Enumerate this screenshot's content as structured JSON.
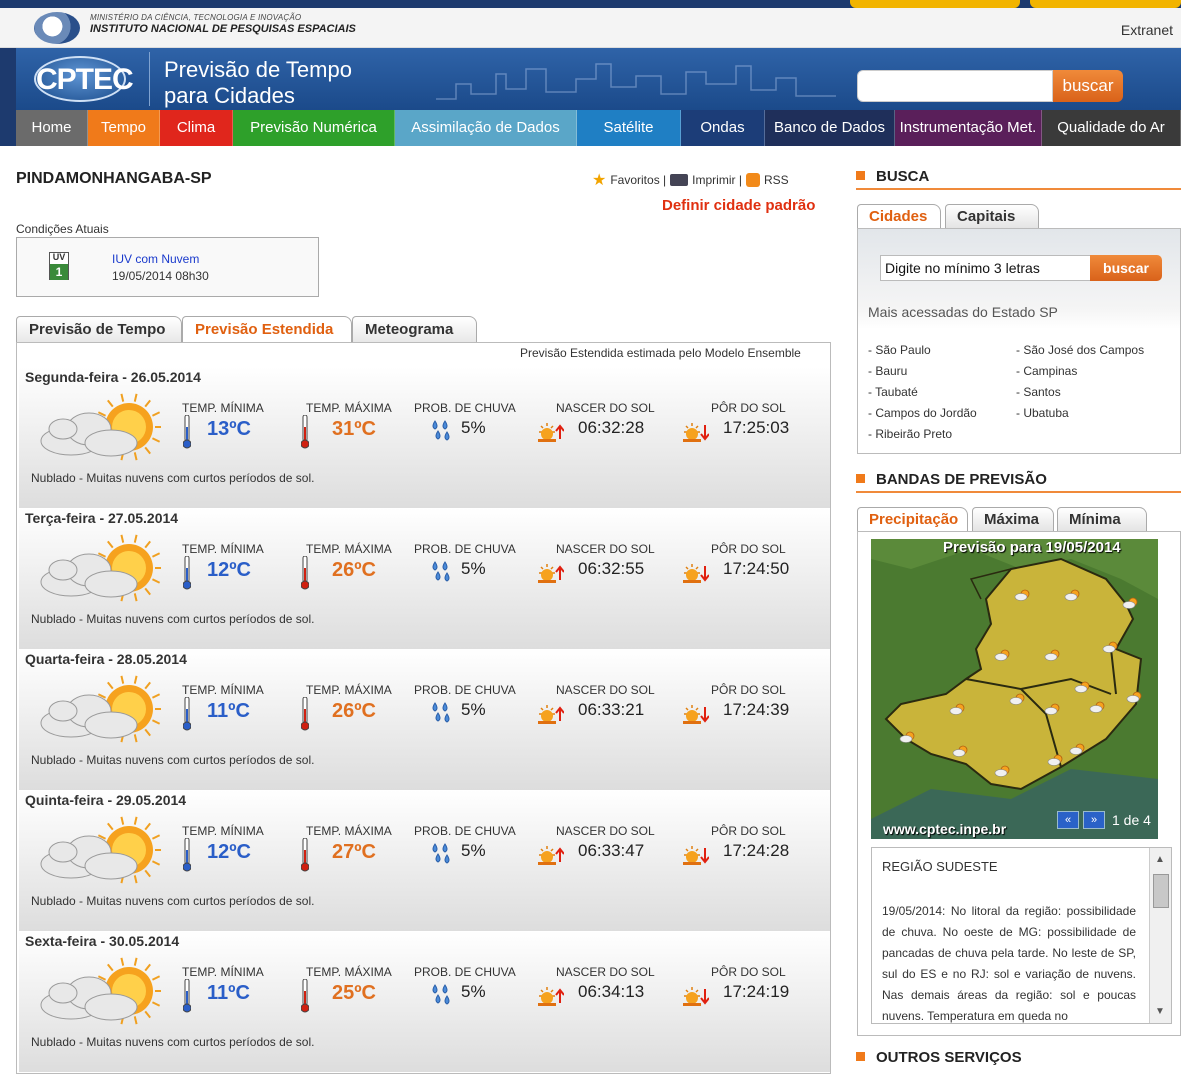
{
  "institution": {
    "line1": "MINISTÉRIO DA CIÊNCIA, TECNOLOGIA E INOVAÇÃO",
    "line2": "INSTITUTO NACIONAL DE PESQUISAS ESPACIAIS",
    "extranet": "Extranet"
  },
  "header": {
    "logo": "CPTEC",
    "title_line1": "Previsão de Tempo",
    "title_line2": "para Cidades",
    "search_button": "buscar"
  },
  "nav": [
    {
      "label": "Home",
      "color": "#6b6b6b"
    },
    {
      "label": "Tempo",
      "color": "#f07a1a"
    },
    {
      "label": "Clima",
      "color": "#e0261c"
    },
    {
      "label": "Previsão Numérica",
      "color": "#2ea02a"
    },
    {
      "label": "Assimilação de Dados",
      "color": "#5aa6c8"
    },
    {
      "label": "Satélite",
      "color": "#1f7fc4"
    },
    {
      "label": "Ondas",
      "color": "#1c3d78"
    },
    {
      "label": "Banco de Dados",
      "color": "#1f2f5a"
    },
    {
      "label": "Instrumentação Met.",
      "color": "#5a1f5a"
    },
    {
      "label": "Qualidade do Ar",
      "color": "#3a3a3a"
    }
  ],
  "city": {
    "name": "PINDAMONHANGABA-SP",
    "favoritos": "Favoritos |",
    "imprimir": "Imprimir |",
    "rss": "RSS",
    "define": "Definir cidade padrão"
  },
  "current": {
    "label": "Condições Atuais",
    "uv_label": "UV",
    "uv_value": "1",
    "link": "IUV com Nuvem",
    "date": "19/05/2014 08h30"
  },
  "tabs": [
    "Previsão de Tempo",
    "Previsão Estendida",
    "Meteograma"
  ],
  "ensemble_note": "Previsão Estendida estimada pelo Modelo Ensemble",
  "labels": {
    "min": "TEMP. MÍNIMA",
    "max": "TEMP. MÁXIMA",
    "rain": "PROB. DE CHUVA",
    "sunrise": "NASCER DO SOL",
    "sunset": "PÔR DO SOL"
  },
  "days": [
    {
      "name": "Segunda-feira - 26.05.2014",
      "min": "13ºC",
      "max": "31ºC",
      "rain": "5%",
      "sunrise": "06:32:28",
      "sunset": "17:25:03",
      "desc": "Nublado - Muitas nuvens com curtos períodos de sol."
    },
    {
      "name": "Terça-feira - 27.05.2014",
      "min": "12ºC",
      "max": "26ºC",
      "rain": "5%",
      "sunrise": "06:32:55",
      "sunset": "17:24:50",
      "desc": "Nublado - Muitas nuvens com curtos períodos de sol."
    },
    {
      "name": "Quarta-feira - 28.05.2014",
      "min": "11ºC",
      "max": "26ºC",
      "rain": "5%",
      "sunrise": "06:33:21",
      "sunset": "17:24:39",
      "desc": "Nublado - Muitas nuvens com curtos períodos de sol."
    },
    {
      "name": "Quinta-feira - 29.05.2014",
      "min": "12ºC",
      "max": "27ºC",
      "rain": "5%",
      "sunrise": "06:33:47",
      "sunset": "17:24:28",
      "desc": "Nublado - Muitas nuvens com curtos períodos de sol."
    },
    {
      "name": "Sexta-feira - 30.05.2014",
      "min": "11ºC",
      "max": "25ºC",
      "rain": "5%",
      "sunrise": "06:34:13",
      "sunset": "17:24:19",
      "desc": "Nublado - Muitas nuvens com curtos períodos de sol."
    }
  ],
  "busca": {
    "title": "BUSCA",
    "tabs": [
      "Cidades",
      "Capitais"
    ],
    "placeholder": "Digite no mínimo 3 letras",
    "button": "buscar",
    "mais": "Mais acessadas do Estado SP",
    "col1": [
      "- São Paulo",
      "- Bauru",
      "- Taubaté",
      "- Campos do Jordão",
      "- Ribeirão Preto"
    ],
    "col2": [
      "- São José dos Campos",
      "- Campinas",
      "- Santos",
      "- Ubatuba"
    ]
  },
  "bandas": {
    "title": "BANDAS DE PREVISÃO",
    "tabs": [
      "Precipitação",
      "Máxima",
      "Mínima"
    ],
    "map_title": "Previsão para 19/05/2014",
    "map_url": "www.cptec.inpe.br",
    "pager": "1 de 4",
    "region": "REGIÃO SUDESTE",
    "text": "19/05/2014: No litoral da região: possibilidade de chuva. No oeste de MG: possibilidade de pancadas de chuva pela tarde. No leste de SP, sul do ES e no RJ: sol e variação de nuvens. Nas demais áreas da região: sol e poucas nuvens. Temperatura em queda no"
  },
  "outros": {
    "title": "OUTROS SERVIÇOS"
  }
}
